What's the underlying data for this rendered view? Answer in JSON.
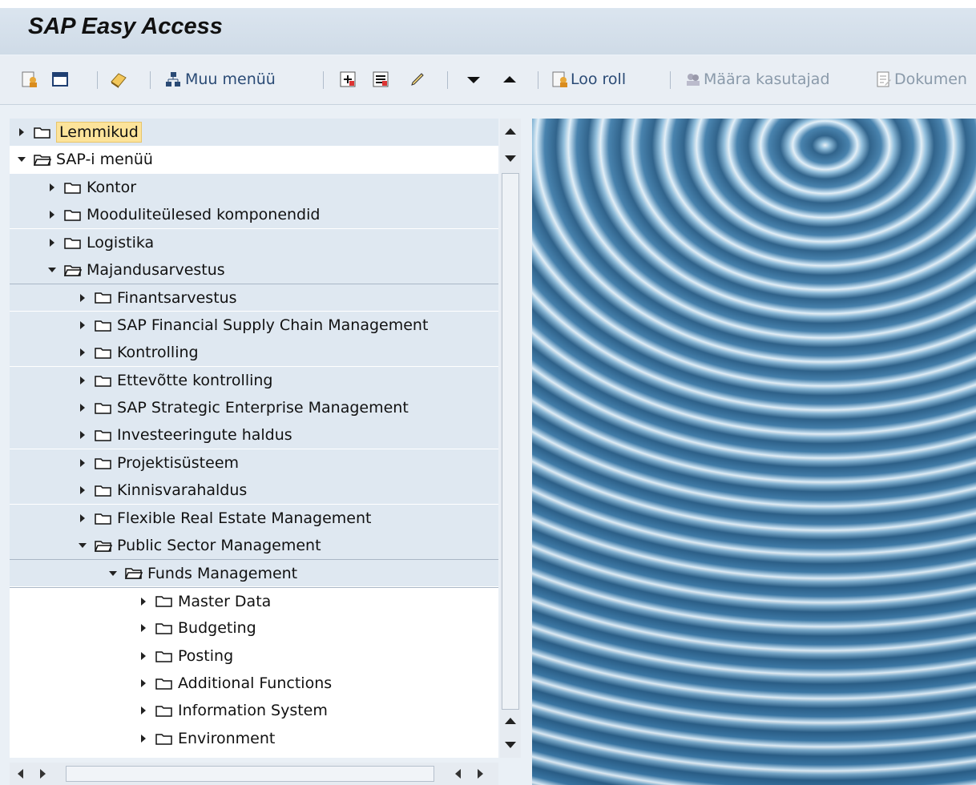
{
  "window": {
    "title": "SAP Easy Access"
  },
  "toolbar": {
    "other_menu": "Muu menüü",
    "create_role": "Loo roll",
    "assign_users": "Määra kasutajad",
    "documentation": "Dokumen"
  },
  "tree": {
    "rows": [
      {
        "label": "Lemmikud",
        "level": 0,
        "state": "collapsed",
        "highlight": true,
        "band": true
      },
      {
        "label": "SAP-i menüü",
        "level": 0,
        "state": "expanded",
        "band": false
      },
      {
        "label": "Kontor",
        "level": 1,
        "state": "collapsed",
        "band": true
      },
      {
        "label": "Mooduliteülesed komponendid",
        "level": 1,
        "state": "collapsed",
        "band": true
      },
      {
        "label": "Logistika",
        "level": 1,
        "state": "collapsed",
        "band": true
      },
      {
        "label": "Majandusarvestus",
        "level": 1,
        "state": "expanded",
        "band": true
      },
      {
        "label": "Finantsarvestus",
        "level": 2,
        "state": "collapsed",
        "band": true
      },
      {
        "label": "SAP Financial Supply Chain Management",
        "level": 2,
        "state": "collapsed",
        "band": true
      },
      {
        "label": "Kontrolling",
        "level": 2,
        "state": "collapsed",
        "band": true
      },
      {
        "label": "Ettevõtte kontrolling",
        "level": 2,
        "state": "collapsed",
        "band": true
      },
      {
        "label": "SAP Strategic Enterprise Management",
        "level": 2,
        "state": "collapsed",
        "band": true
      },
      {
        "label": "Investeeringute haldus",
        "level": 2,
        "state": "collapsed",
        "band": true
      },
      {
        "label": "Projektisüsteem",
        "level": 2,
        "state": "collapsed",
        "band": true
      },
      {
        "label": "Kinnisvarahaldus",
        "level": 2,
        "state": "collapsed",
        "band": true
      },
      {
        "label": "Flexible Real Estate Management",
        "level": 2,
        "state": "collapsed",
        "band": true
      },
      {
        "label": "Public Sector Management",
        "level": 2,
        "state": "expanded",
        "band": true
      },
      {
        "label": "Funds Management",
        "level": 3,
        "state": "expanded",
        "band": true
      },
      {
        "label": "Master Data",
        "level": 4,
        "state": "collapsed",
        "band": false
      },
      {
        "label": "Budgeting",
        "level": 4,
        "state": "collapsed",
        "band": false
      },
      {
        "label": "Posting",
        "level": 4,
        "state": "collapsed",
        "band": false
      },
      {
        "label": "Additional Functions",
        "level": 4,
        "state": "collapsed",
        "band": false
      },
      {
        "label": "Information System",
        "level": 4,
        "state": "collapsed",
        "band": false
      },
      {
        "label": "Environment",
        "level": 4,
        "state": "collapsed",
        "band": false
      }
    ]
  },
  "icons": {
    "favorites": "add-favorite-icon",
    "display": "display-icon",
    "clear": "eraser-icon",
    "other_menu": "hierarchy-icon",
    "up": "triangle-up-icon",
    "down": "triangle-down-icon"
  }
}
